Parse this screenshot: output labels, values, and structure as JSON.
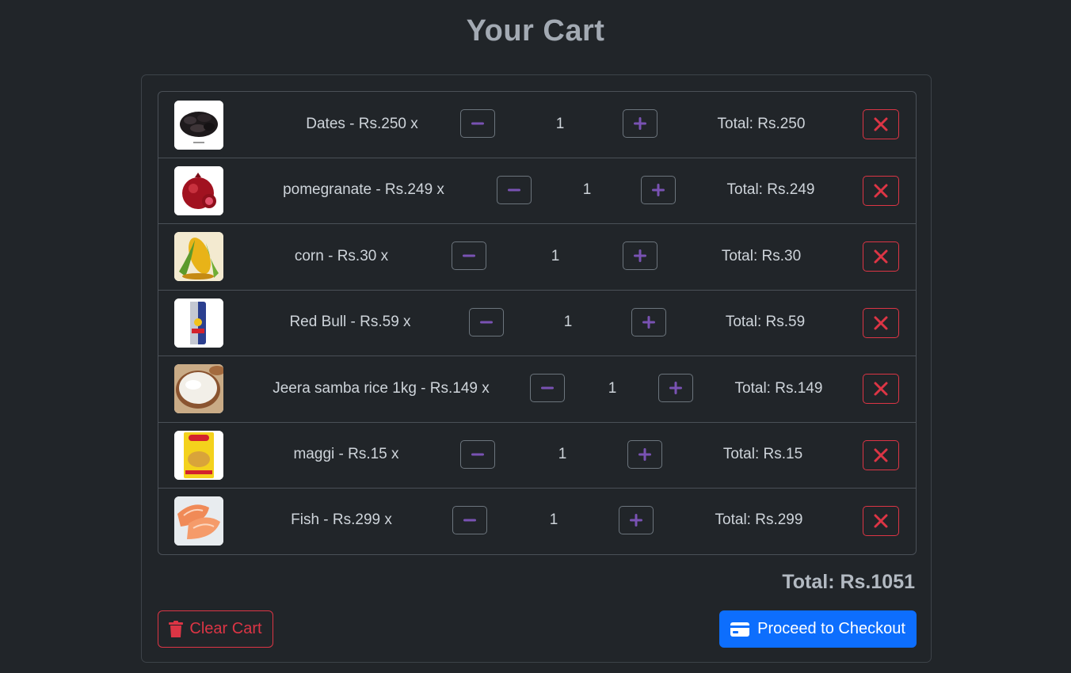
{
  "page": {
    "title": "Your Cart"
  },
  "colors": {
    "background": "#212529",
    "accent": "#7952b3",
    "danger": "#dc3545",
    "primary": "#0d6efd"
  },
  "cart": {
    "items": [
      {
        "label": "Dates - Rs.250 x",
        "quantity": "1",
        "total": "Total: Rs.250",
        "image": "dates-image"
      },
      {
        "label": "pomegranate - Rs.249 x",
        "quantity": "1",
        "total": "Total: Rs.249",
        "image": "pomegranate-image"
      },
      {
        "label": "corn - Rs.30 x",
        "quantity": "1",
        "total": "Total: Rs.30",
        "image": "corn-image"
      },
      {
        "label": "Red Bull - Rs.59 x",
        "quantity": "1",
        "total": "Total: Rs.59",
        "image": "red-bull-image"
      },
      {
        "label": "Jeera samba rice 1kg - Rs.149 x",
        "quantity": "1",
        "total": "Total: Rs.149",
        "image": "rice-image"
      },
      {
        "label": "maggi - Rs.15 x",
        "quantity": "1",
        "total": "Total: Rs.15",
        "image": "maggi-image"
      },
      {
        "label": "Fish - Rs.299 x",
        "quantity": "1",
        "total": "Total: Rs.299",
        "image": "fish-image"
      }
    ],
    "grand_total": "Total: Rs.1051",
    "clear_label": "Clear Cart",
    "checkout_label": "Proceed to Checkout"
  },
  "icons": {
    "decrease": "minus-icon",
    "increase": "plus-icon",
    "remove": "close-icon",
    "clear": "trash-icon",
    "checkout": "credit-card-icon"
  }
}
